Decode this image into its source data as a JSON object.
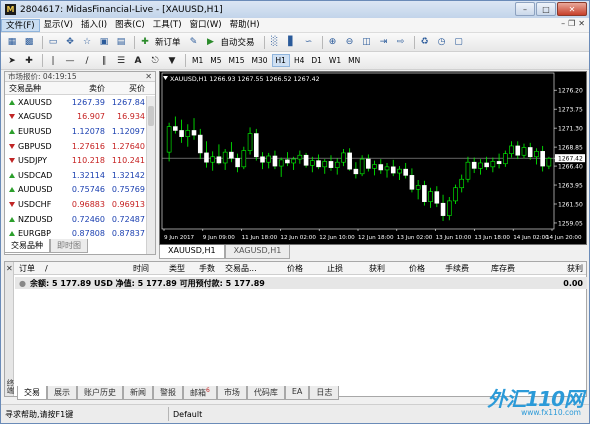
{
  "window": {
    "title": "2804617: MidasFinancial-Live - [XAUUSD,H1]",
    "app_icon_letter": "M"
  },
  "menu": [
    "文件(F)",
    "显示(V)",
    "插入(I)",
    "图表(C)",
    "工具(T)",
    "窗口(W)",
    "帮助(H)"
  ],
  "toolbar": {
    "new_order_label": "新订单",
    "auto_trade_label": "自动交易",
    "timeframes": [
      "M1",
      "M5",
      "M15",
      "M30",
      "H1",
      "H4",
      "D1",
      "W1",
      "MN"
    ],
    "active_timeframe": "H1"
  },
  "market_watch": {
    "title": "市场报价: 04:19:15",
    "columns": [
      "交易品种",
      "卖价",
      "买价"
    ],
    "rows": [
      {
        "symbol": "XAUUSD",
        "bid": "1267.39",
        "ask": "1267.84",
        "dir": "up",
        "color": "blue"
      },
      {
        "symbol": "XAGUSD",
        "bid": "16.907",
        "ask": "16.934",
        "dir": "dn",
        "color": "red"
      },
      {
        "symbol": "EURUSD",
        "bid": "1.12078",
        "ask": "1.12097",
        "dir": "up",
        "color": "blue"
      },
      {
        "symbol": "GBPUSD",
        "bid": "1.27616",
        "ask": "1.27640",
        "dir": "dn",
        "color": "red"
      },
      {
        "symbol": "USDJPY",
        "bid": "110.218",
        "ask": "110.241",
        "dir": "dn",
        "color": "red"
      },
      {
        "symbol": "USDCAD",
        "bid": "1.32114",
        "ask": "1.32142",
        "dir": "up",
        "color": "blue"
      },
      {
        "symbol": "AUDUSD",
        "bid": "0.75746",
        "ask": "0.75769",
        "dir": "up",
        "color": "blue"
      },
      {
        "symbol": "USDCHF",
        "bid": "0.96883",
        "ask": "0.96913",
        "dir": "dn",
        "color": "red"
      },
      {
        "symbol": "NZDUSD",
        "bid": "0.72460",
        "ask": "0.72487",
        "dir": "up",
        "color": "blue"
      },
      {
        "symbol": "EURGBP",
        "bid": "0.87808",
        "ask": "0.87837",
        "dir": "up",
        "color": "blue"
      }
    ],
    "tabs": [
      "交易品种",
      "即时图"
    ]
  },
  "chart": {
    "info": "XAUUSD,H1  1266.93 1267.55 1266.52 1267.42",
    "price_labels": [
      "1276.20",
      "1273.75",
      "1271.30",
      "1268.85",
      "1267.42",
      "1266.40",
      "1263.95",
      "1261.50",
      "1259.05"
    ],
    "current_price": "1267.42",
    "time_labels": [
      "9 Jun 2017",
      "9 Jun 09:00",
      "11 Jun 18:00",
      "12 Jun 02:00",
      "12 Jun 10:00",
      "12 Jun 18:00",
      "13 Jun 02:00",
      "13 Jun 10:00",
      "13 Jun 18:00",
      "14 Jun 02:00",
      "14 Jun 20:00"
    ],
    "tabs": [
      "XAUUSD,H1",
      "XAGUSD,H1"
    ]
  },
  "chart_data": {
    "type": "candlestick",
    "symbol": "XAUUSD",
    "timeframe": "H1",
    "ylim": [
      1258.4,
      1277.0
    ],
    "candles": [
      [
        1268.2,
        1272.0,
        1267.0,
        1271.5
      ],
      [
        1271.5,
        1272.8,
        1270.6,
        1271.0
      ],
      [
        1271.0,
        1272.4,
        1269.4,
        1270.2
      ],
      [
        1270.2,
        1271.8,
        1268.9,
        1271.0
      ],
      [
        1271.0,
        1272.6,
        1269.8,
        1270.4
      ],
      [
        1270.4,
        1271.2,
        1267.3,
        1268.1
      ],
      [
        1268.1,
        1269.6,
        1266.2,
        1266.9
      ],
      [
        1266.9,
        1268.3,
        1265.8,
        1267.6
      ],
      [
        1267.6,
        1269.2,
        1266.6,
        1266.8
      ],
      [
        1266.8,
        1268.6,
        1265.9,
        1268.2
      ],
      [
        1268.2,
        1269.5,
        1266.9,
        1267.4
      ],
      [
        1267.4,
        1268.0,
        1265.6,
        1266.3
      ],
      [
        1266.3,
        1268.9,
        1266.0,
        1268.4
      ],
      [
        1268.4,
        1271.4,
        1267.9,
        1270.6
      ],
      [
        1270.6,
        1271.2,
        1267.1,
        1267.6
      ],
      [
        1267.6,
        1268.2,
        1266.0,
        1266.9
      ],
      [
        1266.9,
        1268.1,
        1266.1,
        1267.7
      ],
      [
        1267.7,
        1268.4,
        1266.0,
        1266.4
      ],
      [
        1266.4,
        1267.5,
        1265.0,
        1267.2
      ],
      [
        1267.2,
        1268.2,
        1266.4,
        1266.8
      ],
      [
        1266.8,
        1267.6,
        1265.9,
        1267.3
      ],
      [
        1267.3,
        1268.4,
        1266.7,
        1267.8
      ],
      [
        1267.8,
        1268.1,
        1266.2,
        1266.5
      ],
      [
        1266.5,
        1267.6,
        1265.6,
        1267.1
      ],
      [
        1267.1,
        1267.9,
        1266.0,
        1266.3
      ],
      [
        1266.3,
        1267.3,
        1265.4,
        1267.0
      ],
      [
        1267.0,
        1267.8,
        1265.8,
        1266.2
      ],
      [
        1266.2,
        1267.4,
        1265.3,
        1266.9
      ],
      [
        1266.9,
        1268.6,
        1266.4,
        1268.1
      ],
      [
        1268.1,
        1268.7,
        1265.8,
        1266.0
      ],
      [
        1266.0,
        1266.9,
        1264.8,
        1265.4
      ],
      [
        1265.4,
        1267.8,
        1265.1,
        1267.3
      ],
      [
        1267.3,
        1267.9,
        1265.7,
        1266.1
      ],
      [
        1266.1,
        1267.1,
        1265.2,
        1266.6
      ],
      [
        1266.6,
        1267.3,
        1265.4,
        1265.9
      ],
      [
        1265.9,
        1266.8,
        1264.9,
        1266.3
      ],
      [
        1266.3,
        1267.2,
        1265.1,
        1265.5
      ],
      [
        1265.5,
        1266.4,
        1264.6,
        1266.0
      ],
      [
        1266.0,
        1266.8,
        1264.8,
        1265.2
      ],
      [
        1265.2,
        1266.1,
        1263.0,
        1263.4
      ],
      [
        1263.4,
        1264.6,
        1262.1,
        1263.9
      ],
      [
        1263.9,
        1264.5,
        1261.3,
        1261.8
      ],
      [
        1261.8,
        1263.6,
        1261.0,
        1263.1
      ],
      [
        1263.1,
        1263.8,
        1261.1,
        1261.6
      ],
      [
        1261.6,
        1262.7,
        1259.3,
        1260.0
      ],
      [
        1260.0,
        1262.4,
        1259.4,
        1261.9
      ],
      [
        1261.9,
        1264.0,
        1261.5,
        1263.6
      ],
      [
        1263.6,
        1265.3,
        1263.0,
        1264.7
      ],
      [
        1264.7,
        1267.6,
        1264.3,
        1266.9
      ],
      [
        1266.9,
        1267.5,
        1265.5,
        1266.1
      ],
      [
        1266.1,
        1267.3,
        1265.3,
        1266.8
      ],
      [
        1266.8,
        1267.6,
        1265.9,
        1266.3
      ],
      [
        1266.3,
        1267.5,
        1265.6,
        1267.0
      ],
      [
        1267.0,
        1268.0,
        1266.1,
        1266.7
      ],
      [
        1266.7,
        1268.4,
        1266.3,
        1268.0
      ],
      [
        1268.0,
        1269.6,
        1267.5,
        1269.0
      ],
      [
        1269.0,
        1269.6,
        1267.3,
        1267.8
      ],
      [
        1267.8,
        1269.3,
        1267.4,
        1268.8
      ],
      [
        1268.8,
        1269.4,
        1267.2,
        1267.6
      ],
      [
        1267.6,
        1268.7,
        1266.6,
        1268.3
      ],
      [
        1268.3,
        1269.0,
        1265.7,
        1266.4
      ],
      [
        1266.4,
        1267.6,
        1266.0,
        1267.4
      ]
    ]
  },
  "terminal": {
    "columns": [
      "订单",
      "/",
      "时间",
      "类型",
      "手数",
      "交易品...",
      "价格",
      "止损",
      "获利",
      "价格",
      "手续费",
      "库存费",
      "获利"
    ],
    "balance_row": "余额: 5 177.89 USD  净值: 5 177.89  可用预付款: 5 177.89",
    "balance_value": "0.00",
    "side_label": "终端",
    "tabs": [
      "交易",
      "展示",
      "账户历史",
      "新闻",
      "警报",
      "邮箱",
      "市场",
      "代码库",
      "EA",
      "日志"
    ],
    "mail_count": "6"
  },
  "status": {
    "help_text": "寻求帮助,请按F1键",
    "profile": "Default"
  },
  "watermark": {
    "logo": "外汇110网",
    "url": "www.fx110.com"
  },
  "colors": {
    "bull_candle": "#000000",
    "bull_candle_outline": "#00ff00",
    "bear_candle": "#ffffff",
    "wick": "#00ff00",
    "grid": "#000000",
    "chart_bg": "#000000"
  }
}
